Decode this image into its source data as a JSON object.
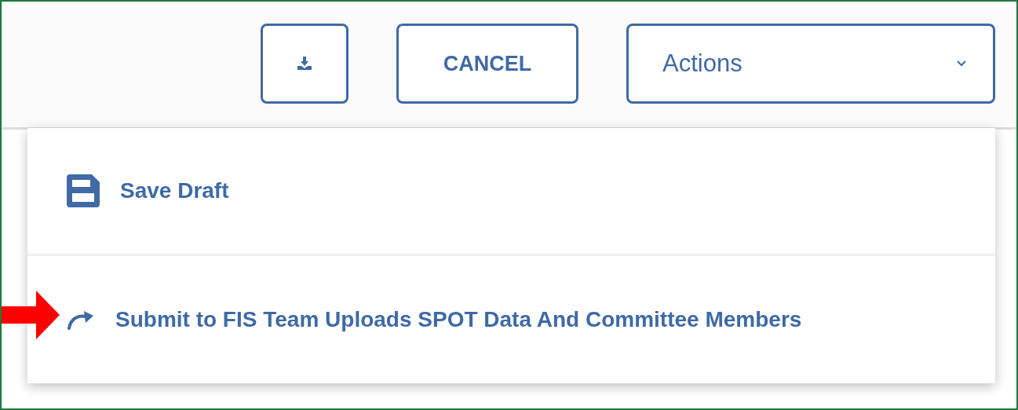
{
  "toolbar": {
    "cancel_button": "CANCEL",
    "actions_dropdown": {
      "label": "Actions",
      "expanded": true
    }
  },
  "actions_menu": [
    {
      "kind": "save",
      "label": "Save Draft"
    },
    {
      "kind": "submit",
      "label": "Submit to FIS Team Uploads SPOT Data And Committee Members"
    }
  ]
}
